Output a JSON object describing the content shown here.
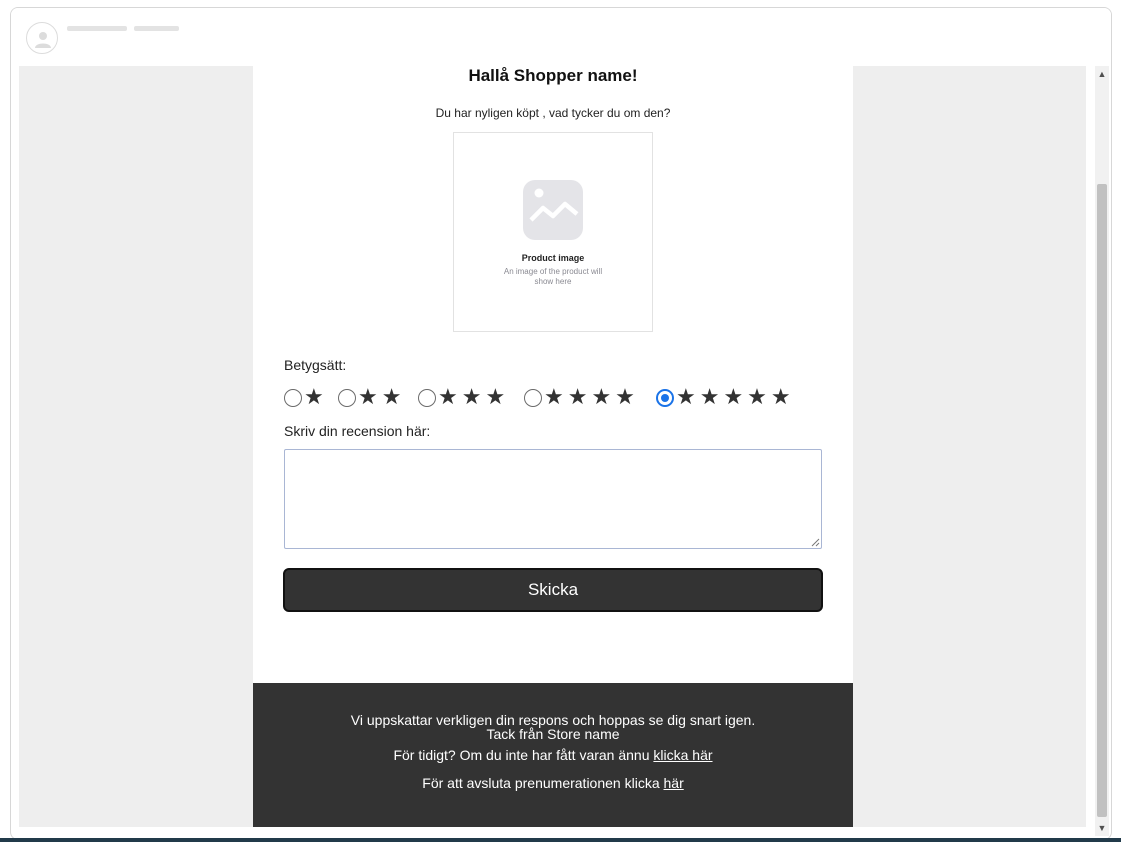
{
  "email": {
    "greeting": "Hallå Shopper name!",
    "subtitle": "Du har nyligen köpt , vad tycker du om den?",
    "product": {
      "title": "Product image",
      "subtitle": "An image of the product will show here"
    },
    "rating": {
      "label": "Betygsätt:",
      "options": [
        {
          "stars": "★",
          "value": 1
        },
        {
          "stars": "★★",
          "value": 2
        },
        {
          "stars": "★★★",
          "value": 3
        },
        {
          "stars": "★★★★",
          "value": 4
        },
        {
          "stars": "★★★★★",
          "value": 5
        }
      ],
      "selected": 5
    },
    "review": {
      "label": "Skriv din recension här:",
      "value": ""
    },
    "submit_label": "Skicka",
    "footer": {
      "line1": "Vi uppskattar verkligen din respons och hoppas se dig snart igen.",
      "line2": "Tack från Store name",
      "line3_text": "För tidigt? Om du inte har fått varan ännu",
      "line3_link": "klicka här",
      "line4_text": "För att avsluta prenumerationen klicka",
      "line4_link": "här"
    }
  },
  "colors": {
    "background": "#eeeeee",
    "button": "#333333",
    "footer": "#333333",
    "radio_selected": "#1a73e8"
  },
  "icons": {
    "avatar": "user-avatar-icon",
    "product": "image-placeholder-icon",
    "star": "star-icon"
  }
}
